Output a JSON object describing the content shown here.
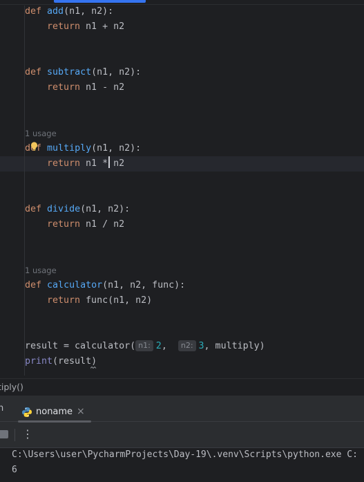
{
  "editor": {
    "lines": {
      "add_def": {
        "kw": "def",
        "name": "add",
        "rest": "(n1, n2):"
      },
      "add_ret": {
        "kw": "return",
        "rest": " n1 + n2"
      },
      "sub_def": {
        "kw": "def",
        "name": "subtract",
        "rest": "(n1, n2):"
      },
      "sub_ret": {
        "kw": "return",
        "rest": " n1 - n2"
      },
      "mul_usage": "1 usage",
      "mul_def": {
        "kw": "def",
        "name": "multiply",
        "rest": "(n1, n2):"
      },
      "mul_ret": {
        "kw": "return",
        "before_caret": " n1 *",
        "after_caret": " n2"
      },
      "div_def": {
        "kw": "def",
        "name": "divide",
        "rest": "(n1, n2):"
      },
      "div_ret": {
        "kw": "return",
        "rest": " n1 / n2"
      },
      "calc_usage": "1 usage",
      "calc_def": {
        "kw": "def",
        "name": "calculator",
        "rest": "(n1, n2, func):"
      },
      "calc_ret": {
        "kw": "return",
        "rest": " func(n1, n2)"
      },
      "result": {
        "lhs": "result = calculator(",
        "hint1": "n1:",
        "arg1": "2",
        "comma1": ",",
        "hint2": "n2:",
        "arg2": "3",
        "tail": ", multiply)"
      },
      "print": {
        "fn": "print",
        "rest": "(result)"
      }
    }
  },
  "breadcrumb": "tiply()",
  "run_panel": {
    "prev_tab": "n",
    "tab_label": "noname",
    "tab_close": "×",
    "tab_icon": "python-icon",
    "more_label": "⋮",
    "console_lines": [
      "C:\\Users\\user\\PycharmProjects\\Day-19\\.venv\\Scripts\\python.exe C:",
      "6"
    ]
  },
  "colors": {
    "background": "#1e1f22",
    "keyword": "#cf8e6d",
    "function": "#56a8f5",
    "builtin": "#8888c6",
    "number": "#2aacb8",
    "accent": "#3574f0"
  }
}
